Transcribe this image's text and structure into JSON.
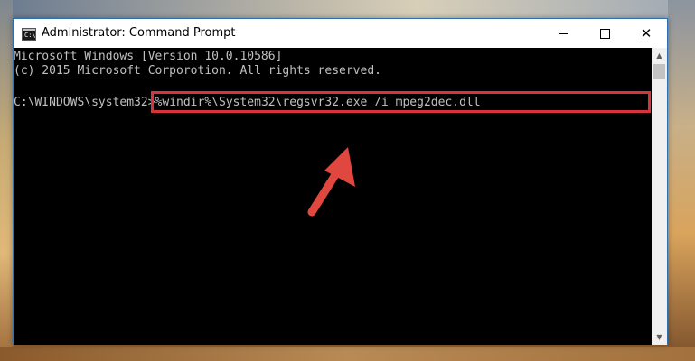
{
  "window": {
    "title": "Administrator: Command Prompt",
    "icon": "cmd-icon",
    "icon_text": "C:\\",
    "controls": [
      "minimize-icon",
      "maximize-icon",
      "close-icon"
    ]
  },
  "console": {
    "lines": [
      "Microsoft Windows [Version 10.0.10586]",
      "(c) 2015 Microsoft Corporotion. All rights reserved."
    ],
    "prompt": "C:\\WINDOWS\\system32>",
    "command": "%windir%\\System32\\regsvr32.exe /i mpeg2dec.dll"
  },
  "annotation": {
    "highlight_color": "#d6333b",
    "arrow_color": "#e0483f"
  },
  "colors": {
    "console_background": "#000000",
    "console_text": "#c0c0c0"
  }
}
